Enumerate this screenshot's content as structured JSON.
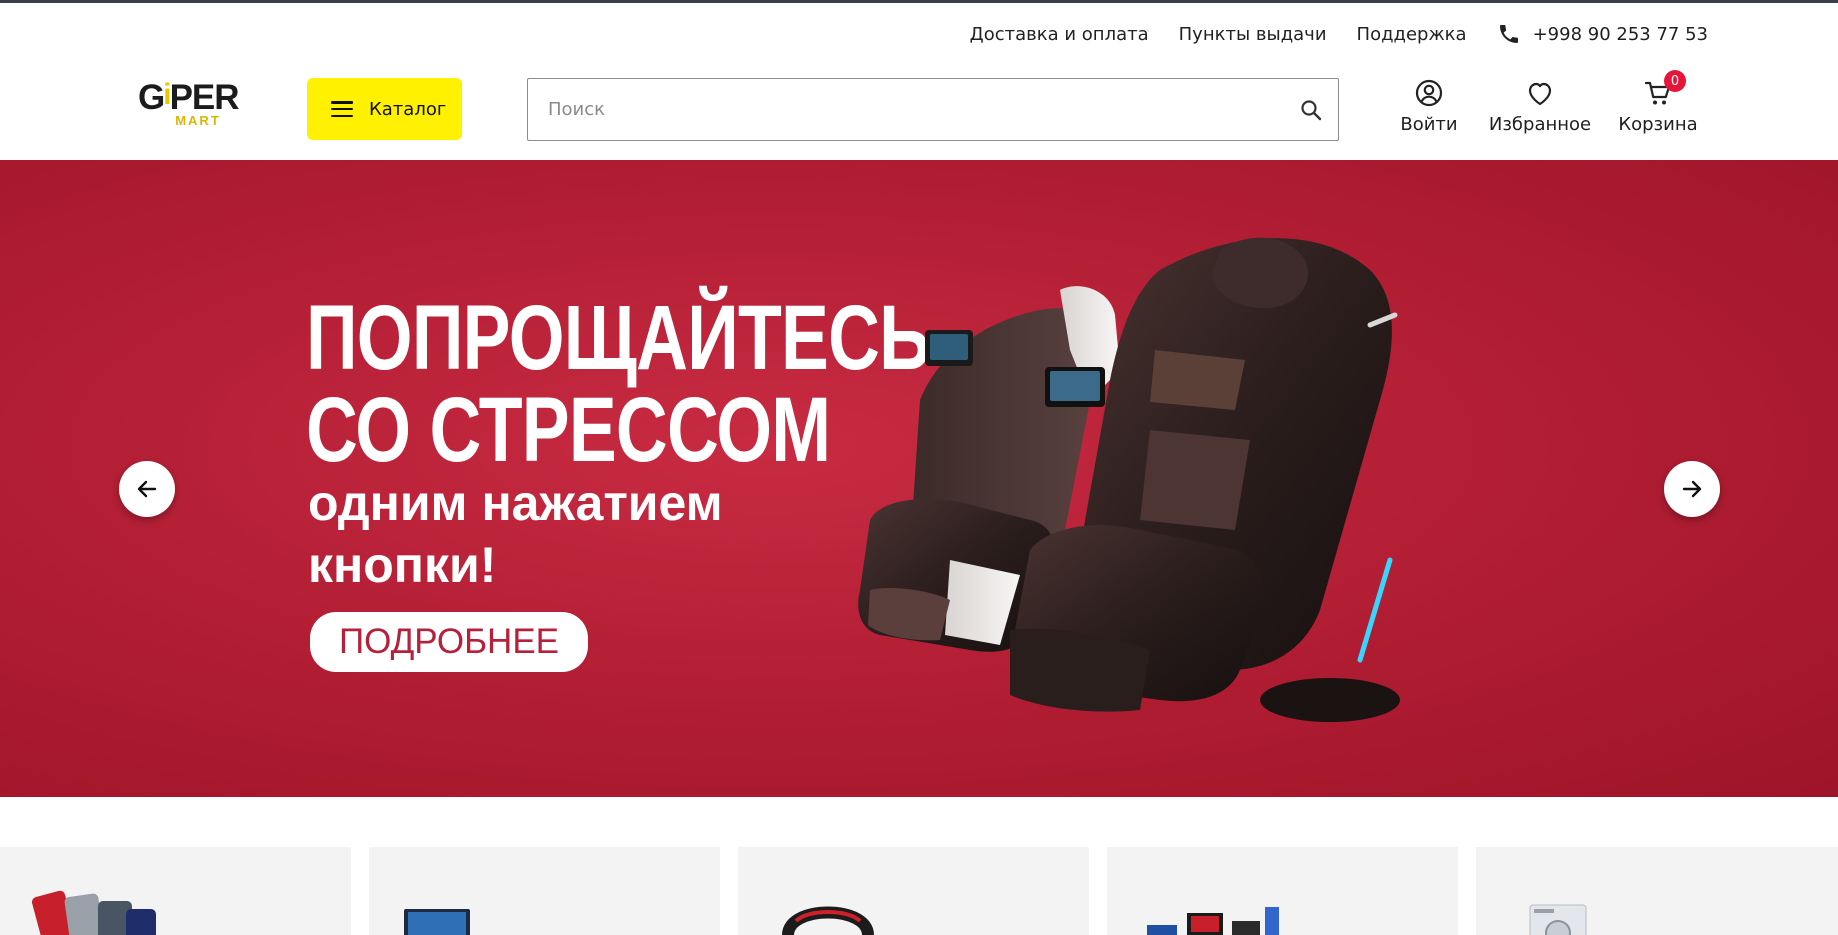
{
  "topbar": {
    "links": [
      "Доставка и оплата",
      "Пункты выдачи",
      "Поддержка"
    ],
    "phone": "+998 90 253 77 53"
  },
  "logo": {
    "main_left": "G",
    "main_i": "i",
    "main_right": "PER",
    "sub": "MART"
  },
  "catalog": {
    "label": "Каталог"
  },
  "search": {
    "placeholder": "Поиск"
  },
  "actions": {
    "login": "Войти",
    "favorites": "Избранное",
    "cart": "Корзина",
    "cart_count": "0"
  },
  "banner": {
    "headline_1": "ПОПРОЩАЙТЕСЬ",
    "headline_2": "СО СТРЕССОМ",
    "subline_1": "одним нажатием",
    "subline_2": "кнопки!",
    "button": "ПОДРОБНЕЕ",
    "background": "#b41f35"
  },
  "colors": {
    "accent": "#fff100",
    "badge": "#e6163b",
    "brand_red": "#b6203a"
  },
  "categories": [
    "smartphones",
    "laptops",
    "gaming-steering-wheel",
    "computer-setup",
    "washing-machine"
  ]
}
